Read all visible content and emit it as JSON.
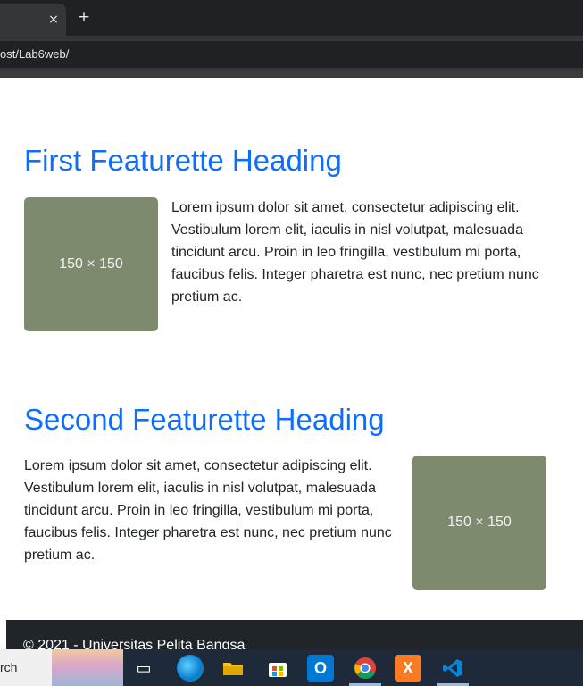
{
  "browser": {
    "tab_close_glyph": "×",
    "new_tab_glyph": "+",
    "url": "ost/Lab6web/"
  },
  "page": {
    "sections": [
      {
        "heading": "First Featurette Heading",
        "image_label": "150 × 150",
        "text": "Lorem ipsum dolor sit amet, consectetur adipiscing elit. Vestibulum lorem elit, iaculis in nisl volutpat, malesuada tincidunt arcu. Proin in leo fringilla, vestibulum mi porta, faucibus felis. Integer pharetra est nunc, nec pretium nunc pretium ac."
      },
      {
        "heading": "Second Featurette Heading",
        "image_label": "150 × 150",
        "text": "Lorem ipsum dolor sit amet, consectetur adipiscing elit. Vestibulum lorem elit, iaculis in nisl volutpat, malesuada tincidunt arcu. Proin in leo fringilla, vestibulum mi porta, faucibus felis. Integer pharetra est nunc, nec pretium nunc pretium ac."
      }
    ],
    "footer": "© 2021 - Universitas Pelita Bangsa"
  },
  "taskbar": {
    "search_text": "rch",
    "icons": [
      "task-view-icon",
      "edge-icon",
      "file-explorer-icon",
      "store-icon",
      "outlook-icon",
      "chrome-icon",
      "xampp-icon",
      "vscode-icon"
    ]
  },
  "colors": {
    "heading": "#0d6efd",
    "placeholder": "#7d8a6d",
    "footer": "#212529"
  }
}
